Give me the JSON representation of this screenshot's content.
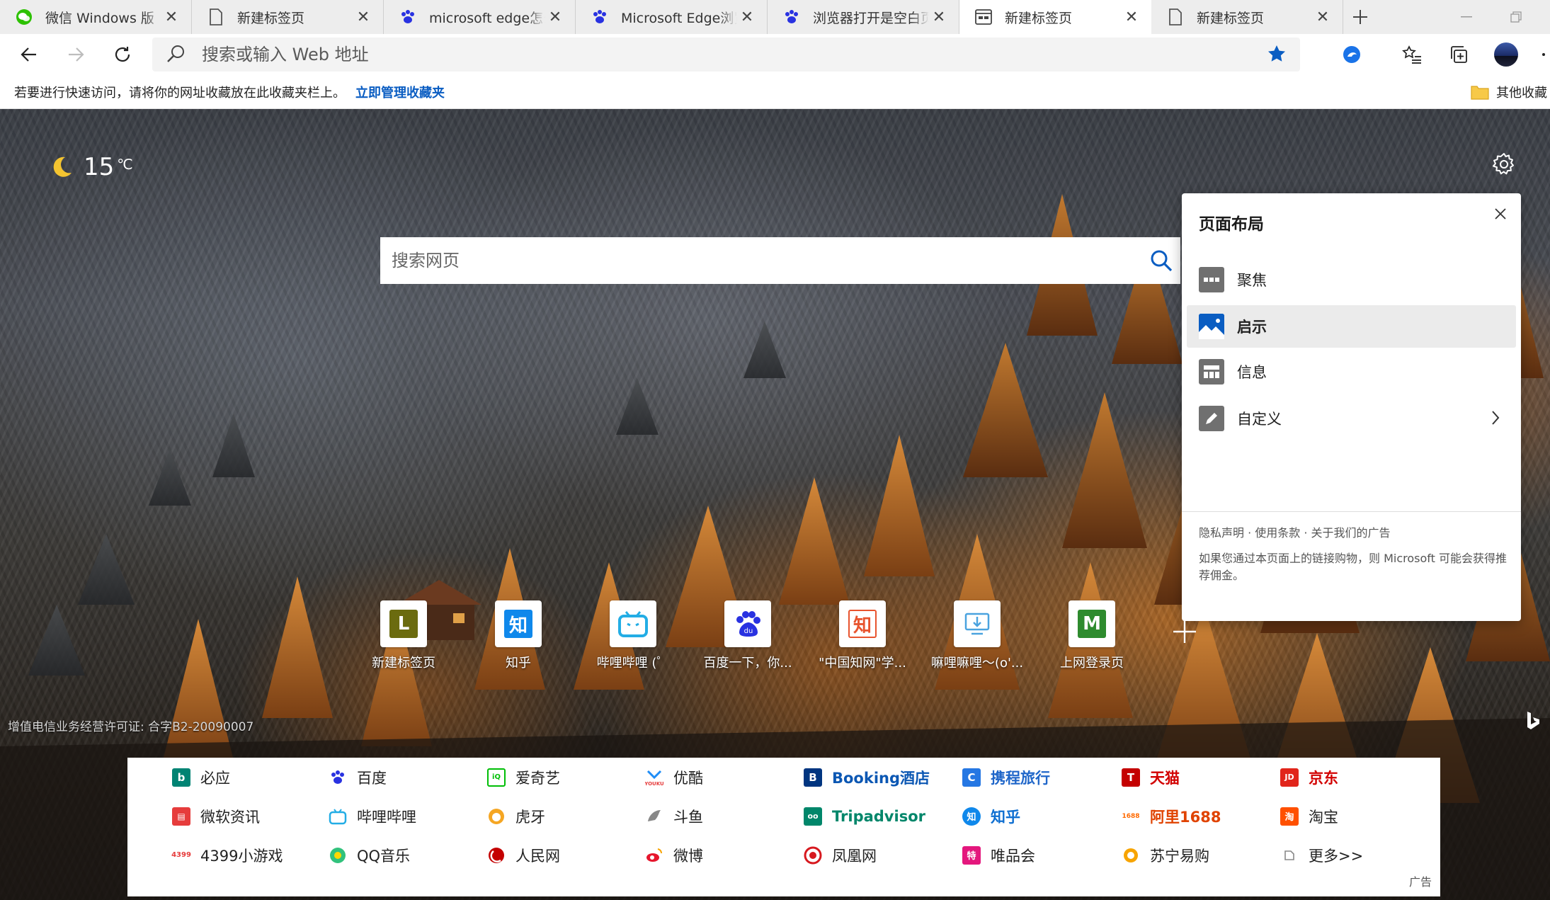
{
  "tabs": [
    {
      "title": "微信 Windows 版",
      "icon": "wechat-icon",
      "active": false
    },
    {
      "title": "新建标签页",
      "icon": "page-icon",
      "active": false
    },
    {
      "title": "microsoft edge怎么改",
      "icon": "baidu-paw-icon",
      "active": false
    },
    {
      "title": "Microsoft Edge浏览器",
      "icon": "baidu-paw-icon",
      "active": false
    },
    {
      "title": "浏览器打开是空白页a",
      "icon": "baidu-paw-icon",
      "active": false
    },
    {
      "title": "新建标签页",
      "icon": "newtab-page-icon",
      "active": true
    },
    {
      "title": "新建标签页",
      "icon": "page-icon",
      "active": false
    }
  ],
  "toolbar": {
    "address_placeholder": "搜索或输入 Web 地址"
  },
  "favbar": {
    "hint": "若要进行快速访问，请将你的网址收藏放在此收藏夹栏上。",
    "manage_link": "立即管理收藏夹",
    "other_favorites": "其他收藏"
  },
  "weather": {
    "temp": "15",
    "unit": "℃"
  },
  "hero_search": {
    "placeholder": "搜索网页"
  },
  "layout_panel": {
    "title": "页面布局",
    "items": [
      {
        "label": "聚焦",
        "selected": false
      },
      {
        "label": "启示",
        "selected": true
      },
      {
        "label": "信息",
        "selected": false
      },
      {
        "label": "自定义",
        "selected": false
      }
    ],
    "links": "隐私声明 · 使用条款 · 关于我们的广告",
    "note": "如果您通过本页面上的链接购物，则 Microsoft 可能会获得推荐佣金。"
  },
  "quick_links": [
    {
      "label": "新建标签页",
      "badge": "L",
      "color": "#6b6b0f"
    },
    {
      "label": "知乎",
      "badge": "知",
      "color": "#0f88eb"
    },
    {
      "label": "哔哩哔哩 (゜",
      "badge": "",
      "color": "#23ade5"
    },
    {
      "label": "百度一下，你...",
      "badge": "",
      "color": "#2932e1"
    },
    {
      "label": "\"中国知网\"学...",
      "badge": "知",
      "color": "#e8542e"
    },
    {
      "label": "嘛哩嘛哩～(o'...",
      "badge": "",
      "color": "#4aa3df"
    },
    {
      "label": "上网登录页",
      "badge": "M",
      "color": "#2e8b2e"
    }
  ],
  "icp": "增值电信业务经营许可证: 合字B2-20090007",
  "link_grid": {
    "rows": [
      [
        {
          "label": "必应",
          "color": "#008373",
          "brand": false
        },
        {
          "label": "百度",
          "color": "#2932e1",
          "brand": false
        },
        {
          "label": "爱奇艺",
          "color": "#00be06",
          "brand": false
        },
        {
          "label": "优酷",
          "color": "#1f8df6",
          "brand": false
        },
        {
          "label": "Booking酒店",
          "color": "#003580",
          "brand": true,
          "text_color": "#0b57b3"
        },
        {
          "label": "携程旅行",
          "color": "#2577e3",
          "brand": true,
          "text_color": "#1f66c9"
        },
        {
          "label": "天猫",
          "color": "#c40000",
          "brand": true,
          "text_color": "#d20000"
        },
        {
          "label": "京东",
          "color": "#e1251b",
          "brand": true,
          "text_color": "#d20000"
        }
      ],
      [
        {
          "label": "微软资讯",
          "color": "#e63c3c",
          "brand": false
        },
        {
          "label": "哔哩哔哩",
          "color": "#23ade5",
          "brand": false
        },
        {
          "label": "虎牙",
          "color": "#f5a623",
          "brand": false
        },
        {
          "label": "斗鱼",
          "color": "#888888",
          "brand": false
        },
        {
          "label": "Tripadvisor",
          "color": "#00866a",
          "brand": true,
          "text_color": "#00866a"
        },
        {
          "label": "知乎",
          "color": "#0f88eb",
          "brand": true,
          "text_color": "#0f6fd1"
        },
        {
          "label": "阿里1688",
          "color": "#ff6a00",
          "brand": true,
          "text_color": "#e04300"
        },
        {
          "label": "淘宝",
          "color": "#ff5000",
          "brand": false
        }
      ],
      [
        {
          "label": "4399小游戏",
          "color": "#e63c3c",
          "brand": false
        },
        {
          "label": "QQ音乐",
          "color": "#31c27c",
          "brand": false
        },
        {
          "label": "人民网",
          "color": "#c40000",
          "brand": false
        },
        {
          "label": "微博",
          "color": "#e6162d",
          "brand": false
        },
        {
          "label": "凤凰网",
          "color": "#d7191f",
          "brand": false
        },
        {
          "label": "唯品会",
          "color": "#e4177d",
          "brand": false
        },
        {
          "label": "苏宁易购",
          "color": "#f7a400",
          "brand": false
        },
        {
          "label": "更多>>",
          "color": "#888888",
          "brand": false
        }
      ]
    ],
    "ad_label": "广告"
  }
}
